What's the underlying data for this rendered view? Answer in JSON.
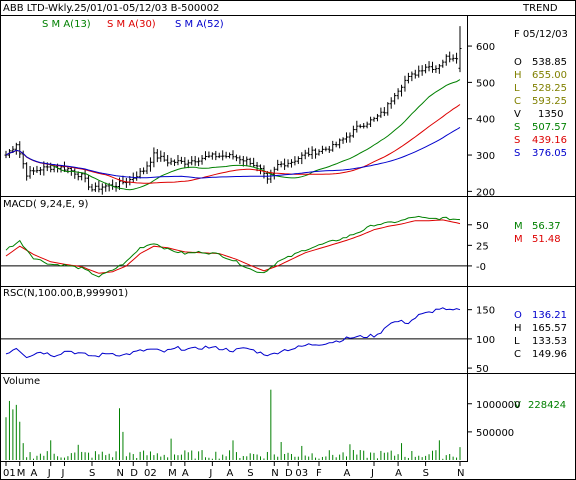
{
  "header": {
    "title": "ABB LTD-Wkly.25/01/01-05/12/03  B-500002",
    "trend_label": "TREND",
    "date_label": "F 05/12/03",
    "sma_legend": [
      {
        "label": "S M A(13)",
        "color": "#008000"
      },
      {
        "label": "S M A(30)",
        "color": "#dd0000"
      },
      {
        "label": "S M A(52)",
        "color": "#0000cc"
      }
    ]
  },
  "colors": {
    "price_bars": "#000000",
    "sma13": "#008000",
    "sma30": "#dd0000",
    "sma52": "#0000cc",
    "macd": "#008000",
    "signal": "#dd0000",
    "rsc": "#0000cc",
    "volume": "#008000"
  },
  "stats": {
    "price": [
      {
        "label": "O",
        "value": "538.85",
        "color": "#000000"
      },
      {
        "label": "H",
        "value": "655.00",
        "color": "#808000"
      },
      {
        "label": "L",
        "value": "528.25",
        "color": "#808000"
      },
      {
        "label": "C",
        "value": "593.25",
        "color": "#808000"
      },
      {
        "label": "V",
        "value": "1350",
        "color": "#000000"
      },
      {
        "label": "S",
        "value": "507.57",
        "color": "#008000"
      },
      {
        "label": "S",
        "value": "439.16",
        "color": "#dd0000"
      },
      {
        "label": "S",
        "value": "376.05",
        "color": "#0000cc"
      }
    ],
    "macd": [
      {
        "label": "M",
        "value": "56.37",
        "color": "#008000"
      },
      {
        "label": "M",
        "value": "51.48",
        "color": "#dd0000"
      }
    ],
    "rsc": [
      {
        "label": "O",
        "value": "136.21",
        "color": "#0000cc"
      },
      {
        "label": "H",
        "value": "165.57",
        "color": "#000000"
      },
      {
        "label": "L",
        "value": "133.53",
        "color": "#000000"
      },
      {
        "label": "C",
        "value": "149.96",
        "color": "#000000"
      }
    ],
    "volume": [
      {
        "label": "V",
        "value": "228424",
        "color": "#008000"
      }
    ]
  },
  "chart_data": [
    {
      "type": "ohlc",
      "panel": "price",
      "ylim": [
        190,
        680
      ],
      "yticks": [
        200,
        300,
        400,
        500,
        600
      ],
      "x_labels": [
        "01",
        "M",
        "A",
        "J",
        "J",
        "S",
        "N",
        "D",
        "02",
        "M",
        "A",
        "J",
        "A",
        "S",
        "N",
        "D",
        "03",
        "F",
        "A",
        "J",
        "A",
        "S",
        "N"
      ],
      "x_label_weeks": [
        0,
        4,
        8,
        13,
        17,
        25,
        33,
        37,
        41,
        48,
        52,
        60,
        65,
        71,
        78,
        82,
        85,
        91,
        99,
        107,
        114,
        122,
        132
      ],
      "series": [
        {
          "name": "S M A(13)",
          "values_approx": "weekly SMA of close, ends 507.57"
        },
        {
          "name": "S M A(30)",
          "values_approx": "weekly SMA of close, ends 439.16"
        },
        {
          "name": "S M A(52)",
          "values_approx": "weekly SMA of close, ends 376.05"
        }
      ],
      "close_anchors": [
        [
          0,
          300
        ],
        [
          3,
          332
        ],
        [
          6,
          248
        ],
        [
          10,
          262
        ],
        [
          14,
          268
        ],
        [
          18,
          262
        ],
        [
          22,
          242
        ],
        [
          25,
          205
        ],
        [
          28,
          213
        ],
        [
          32,
          218
        ],
        [
          36,
          232
        ],
        [
          40,
          258
        ],
        [
          43,
          300
        ],
        [
          47,
          282
        ],
        [
          52,
          280
        ],
        [
          57,
          292
        ],
        [
          61,
          298
        ],
        [
          66,
          296
        ],
        [
          71,
          282
        ],
        [
          74,
          258
        ],
        [
          76,
          228
        ],
        [
          79,
          272
        ],
        [
          83,
          282
        ],
        [
          87,
          302
        ],
        [
          91,
          312
        ],
        [
          95,
          322
        ],
        [
          99,
          350
        ],
        [
          103,
          382
        ],
        [
          107,
          398
        ],
        [
          110,
          420
        ],
        [
          113,
          470
        ],
        [
          116,
          505
        ],
        [
          119,
          525
        ],
        [
          122,
          545
        ],
        [
          125,
          540
        ],
        [
          128,
          568
        ],
        [
          131,
          572
        ],
        [
          132,
          593.25
        ]
      ]
    },
    {
      "type": "line",
      "panel": "MACD(9,24,E,9)",
      "ylim": [
        -22,
        68
      ],
      "yticks": [
        50,
        25,
        0
      ],
      "series": [
        {
          "name": "M",
          "last": 56.37,
          "anchors": [
            [
              0,
              20
            ],
            [
              4,
              30
            ],
            [
              8,
              10
            ],
            [
              13,
              2
            ],
            [
              17,
              1
            ],
            [
              22,
              -3
            ],
            [
              27,
              -13
            ],
            [
              31,
              -5
            ],
            [
              35,
              5
            ],
            [
              39,
              22
            ],
            [
              43,
              28
            ],
            [
              47,
              20
            ],
            [
              52,
              15
            ],
            [
              57,
              17
            ],
            [
              62,
              14
            ],
            [
              67,
              5
            ],
            [
              72,
              -6
            ],
            [
              75,
              -8
            ],
            [
              79,
              5
            ],
            [
              83,
              12
            ],
            [
              87,
              20
            ],
            [
              91,
              25
            ],
            [
              95,
              30
            ],
            [
              99,
              35
            ],
            [
              103,
              42
            ],
            [
              107,
              50
            ],
            [
              111,
              52
            ],
            [
              115,
              55
            ],
            [
              119,
              60
            ],
            [
              123,
              57
            ],
            [
              127,
              58
            ],
            [
              132,
              56.37
            ]
          ]
        },
        {
          "name": "M",
          "last": 51.48,
          "anchors": [
            [
              0,
              12
            ],
            [
              4,
              24
            ],
            [
              8,
              14
            ],
            [
              13,
              5
            ],
            [
              17,
              2
            ],
            [
              22,
              -1
            ],
            [
              27,
              -9
            ],
            [
              31,
              -7
            ],
            [
              35,
              0
            ],
            [
              39,
              15
            ],
            [
              43,
              24
            ],
            [
              47,
              22
            ],
            [
              52,
              17
            ],
            [
              57,
              16
            ],
            [
              62,
              15
            ],
            [
              67,
              8
            ],
            [
              72,
              -1
            ],
            [
              75,
              -6
            ],
            [
              79,
              0
            ],
            [
              83,
              8
            ],
            [
              87,
              16
            ],
            [
              91,
              21
            ],
            [
              95,
              26
            ],
            [
              99,
              31
            ],
            [
              103,
              37
            ],
            [
              107,
              44
            ],
            [
              111,
              48
            ],
            [
              115,
              51
            ],
            [
              119,
              55
            ],
            [
              123,
              55
            ],
            [
              127,
              56
            ],
            [
              132,
              51.48
            ]
          ]
        }
      ]
    },
    {
      "type": "line",
      "panel": "RSC(N,100.00,B,999901)",
      "ylim": [
        45,
        170
      ],
      "yticks": [
        150,
        100,
        50
      ],
      "baseline": 100,
      "series": [
        {
          "name": "RSC",
          "anchors": [
            [
              0,
              75
            ],
            [
              3,
              85
            ],
            [
              6,
              70
            ],
            [
              10,
              78
            ],
            [
              14,
              72
            ],
            [
              18,
              80
            ],
            [
              22,
              74
            ],
            [
              26,
              70
            ],
            [
              30,
              76
            ],
            [
              34,
              72
            ],
            [
              38,
              78
            ],
            [
              42,
              82
            ],
            [
              46,
              78
            ],
            [
              50,
              84
            ],
            [
              54,
              82
            ],
            [
              58,
              86
            ],
            [
              62,
              84
            ],
            [
              66,
              80
            ],
            [
              70,
              84
            ],
            [
              74,
              76
            ],
            [
              77,
              72
            ],
            [
              80,
              80
            ],
            [
              84,
              84
            ],
            [
              88,
              90
            ],
            [
              92,
              92
            ],
            [
              96,
              96
            ],
            [
              100,
              102
            ],
            [
              104,
              104
            ],
            [
              108,
              106
            ],
            [
              111,
              125
            ],
            [
              114,
              130
            ],
            [
              117,
              128
            ],
            [
              120,
              140
            ],
            [
              123,
              145
            ],
            [
              126,
              152
            ],
            [
              129,
              148
            ],
            [
              132,
              149.96
            ]
          ]
        }
      ]
    },
    {
      "type": "bar",
      "panel": "Volume",
      "ylim": [
        0,
        1280000
      ],
      "yticks": [
        1000000,
        500000
      ],
      "spikes": [
        [
          0,
          760000
        ],
        [
          1,
          1050000
        ],
        [
          2,
          900000
        ],
        [
          3,
          980000
        ],
        [
          4,
          680000
        ],
        [
          5,
          300000
        ],
        [
          13,
          350000
        ],
        [
          21,
          270000
        ],
        [
          33,
          920000
        ],
        [
          34,
          500000
        ],
        [
          48,
          380000
        ],
        [
          66,
          350000
        ],
        [
          77,
          1250000
        ],
        [
          80,
          320000
        ],
        [
          86,
          250000
        ],
        [
          100,
          280000
        ],
        [
          115,
          300000
        ],
        [
          126,
          350000
        ],
        [
          132,
          228424
        ]
      ]
    }
  ],
  "panels": {
    "macd_label": "MACD( 9,24,E, 9)",
    "rsc_label": "RSC(N,100.00,B,999901)",
    "volume_label": "Volume"
  }
}
